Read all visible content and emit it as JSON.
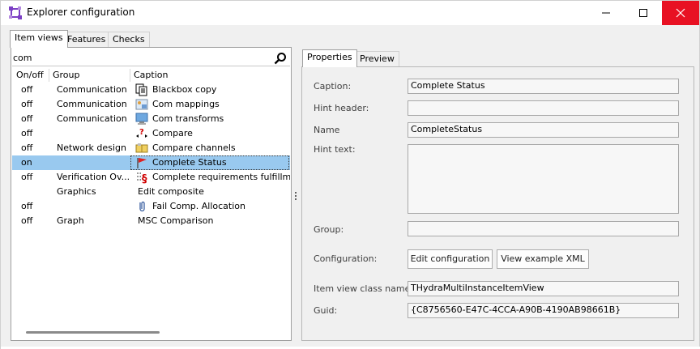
{
  "window": {
    "title": "Explorer configuration",
    "colors": {
      "close_button": "#e81123",
      "selection": "#99c9ef"
    }
  },
  "left": {
    "tabs": [
      {
        "label": "Item views",
        "active": true
      },
      {
        "label": "Features",
        "active": false
      },
      {
        "label": "Checks",
        "active": false
      }
    ],
    "search": {
      "value": "com",
      "icon": "search-icon"
    },
    "columns": [
      "On/off",
      "Group",
      "Caption"
    ],
    "rows": [
      {
        "on": "off",
        "group": "Communication",
        "caption": "Blackbox copy",
        "icon": "document-copy-icon"
      },
      {
        "on": "off",
        "group": "Communication",
        "caption": "Com mappings",
        "icon": "mapping-icon"
      },
      {
        "on": "off",
        "group": "Communication",
        "caption": "Com transforms",
        "icon": "transform-icon"
      },
      {
        "on": "off",
        "group": "",
        "caption": "Compare",
        "icon": "compare-icon"
      },
      {
        "on": "off",
        "group": "Network design",
        "caption": "Compare channels",
        "icon": "compare-channels-icon"
      },
      {
        "on": "on",
        "group": "",
        "caption": "Complete Status",
        "icon": "flag-icon",
        "selected": true
      },
      {
        "on": "off",
        "group": "Verification Ov...",
        "caption": "Complete requirements fulfillm...",
        "icon": "requirements-icon"
      },
      {
        "on": "",
        "group": "Graphics",
        "caption": "Edit composite",
        "icon": ""
      },
      {
        "on": "off",
        "group": "",
        "caption": "Fail Comp. Allocation",
        "icon": "allocation-icon"
      },
      {
        "on": "off",
        "group": "Graph",
        "caption": "MSC Comparison",
        "icon": ""
      }
    ]
  },
  "right": {
    "tabs": [
      {
        "label": "Properties",
        "active": true
      },
      {
        "label": "Preview",
        "active": false
      }
    ],
    "fields": {
      "caption": {
        "label": "Caption:",
        "value": "Complete Status"
      },
      "hint_header": {
        "label": "Hint header:",
        "value": ""
      },
      "name": {
        "label": "Name",
        "value": "CompleteStatus"
      },
      "hint_text": {
        "label": "Hint text:",
        "value": ""
      },
      "group": {
        "label": "Group:",
        "value": ""
      },
      "configuration": {
        "label": "Configuration:"
      },
      "item_view_class": {
        "label": "Item view class name:",
        "value": "THydraMultiInstanceItemView"
      },
      "guid": {
        "label": "Guid:",
        "value": "{C8756560-E47C-4CCA-A90B-4190AB98661B}"
      }
    },
    "buttons": {
      "edit_configuration": "Edit configuration",
      "view_example_xml": "View example XML"
    }
  }
}
